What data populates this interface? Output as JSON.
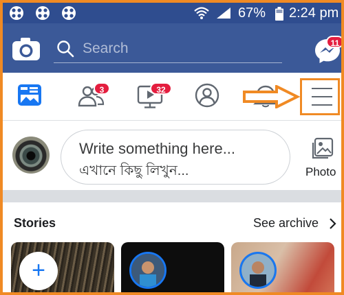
{
  "status_bar": {
    "battery": "67%",
    "time": "2:24 pm",
    "icons": [
      "app-notification-icon",
      "app-notification-icon",
      "app-notification-icon",
      "wifi-icon",
      "signal-icon",
      "battery-icon"
    ]
  },
  "header": {
    "search_placeholder": "Search",
    "messenger_badge": "11",
    "icons": [
      "camera-icon",
      "search-icon",
      "messenger-icon"
    ]
  },
  "tabs": [
    {
      "name": "news-feed",
      "icon": "news-feed-icon",
      "badge": ""
    },
    {
      "name": "friend-requests",
      "icon": "friends-icon",
      "badge": "3"
    },
    {
      "name": "watch",
      "icon": "video-icon",
      "badge": "32"
    },
    {
      "name": "profile",
      "icon": "profile-icon",
      "badge": ""
    },
    {
      "name": "notifications",
      "icon": "bell-icon",
      "badge": ""
    },
    {
      "name": "menu",
      "icon": "hamburger-menu-icon",
      "badge": ""
    }
  ],
  "annotation": {
    "arrow_color": "#f08a24",
    "highlight": "menu"
  },
  "composer": {
    "prompt_line1": "Write something here...",
    "prompt_line2": "এখানে কিছু লিখুন...",
    "photo_label": "Photo"
  },
  "stories": {
    "title": "Stories",
    "see_archive": "See archive",
    "add_symbol": "+"
  },
  "colors": {
    "header_blue": "#3b5998",
    "status_bar_blue": "#2f4d8f",
    "badge_red": "#e41e3f",
    "accent_blue": "#1877f2",
    "frame_orange": "#f08a24"
  }
}
